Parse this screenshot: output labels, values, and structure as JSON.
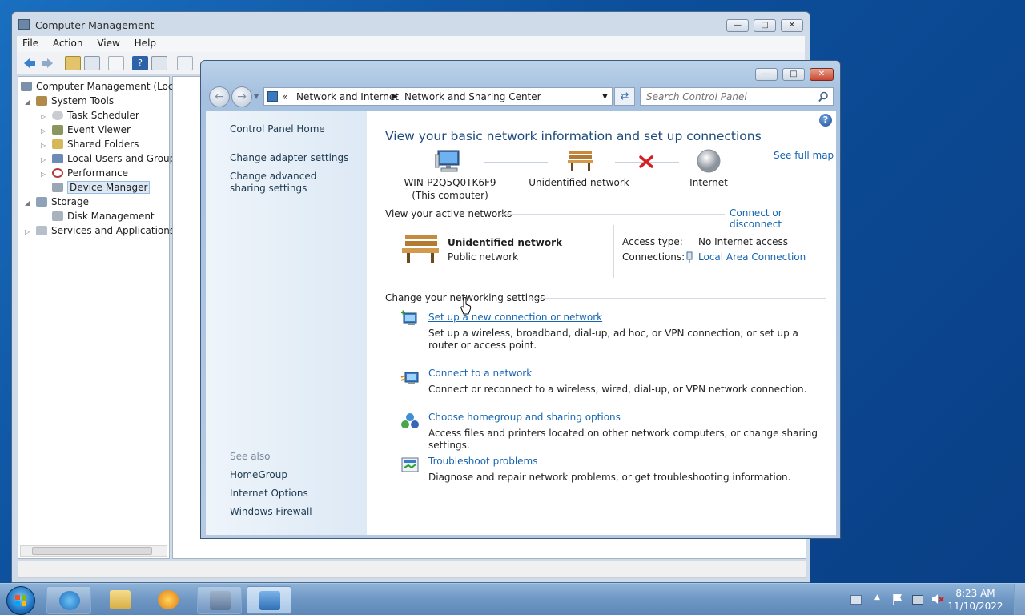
{
  "cm": {
    "title": "Computer Management",
    "menu": [
      "File",
      "Action",
      "View",
      "Help"
    ],
    "tree": [
      "Computer Management (Local",
      "System Tools",
      "Task Scheduler",
      "Event Viewer",
      "Shared Folders",
      "Local Users and Groups",
      "Performance",
      "Device Manager",
      "Storage",
      "Disk Management",
      "Services and Applications"
    ]
  },
  "nsc": {
    "breadcrumb_prefix": "«",
    "breadcrumb": [
      "Network and Internet",
      "Network and Sharing Center"
    ],
    "search_placeholder": "Search Control Panel",
    "nav": {
      "home": "Control Panel Home",
      "adapter": "Change adapter settings",
      "advanced": "Change advanced sharing settings",
      "see_also": "See also",
      "see_also_links": [
        "HomeGroup",
        "Internet Options",
        "Windows Firewall"
      ]
    },
    "heading": "View your basic network information and set up connections",
    "see_full_map": "See full map",
    "map": {
      "computer_name": "WIN-P2Q5Q0TK6F9",
      "computer_sub": "(This computer)",
      "network": "Unidentified network",
      "internet": "Internet"
    },
    "active": {
      "title": "View your active networks",
      "connect_link": "Connect or disconnect",
      "network_name": "Unidentified network",
      "network_type": "Public network",
      "access_label": "Access type:",
      "access_value": "No Internet access",
      "connections_label": "Connections:",
      "connections_value": "Local Area Connection"
    },
    "change": {
      "title": "Change your networking settings",
      "tasks": [
        {
          "link": "Set up a new connection or network",
          "desc": "Set up a wireless, broadband, dial-up, ad hoc, or VPN connection; or set up a router or access point."
        },
        {
          "link": "Connect to a network",
          "desc": "Connect or reconnect to a wireless, wired, dial-up, or VPN network connection."
        },
        {
          "link": "Choose homegroup and sharing options",
          "desc": "Access files and printers located on other network computers, or change sharing settings."
        },
        {
          "link": "Troubleshoot problems",
          "desc": "Diagnose and repair network problems, or get troubleshooting information."
        }
      ]
    }
  },
  "taskbar": {
    "time": "8:23 AM",
    "date": "11/10/2022"
  },
  "colors": {
    "link": "#1565b0",
    "heading": "#1e4a7a",
    "desktop": "#0c4e9a"
  }
}
